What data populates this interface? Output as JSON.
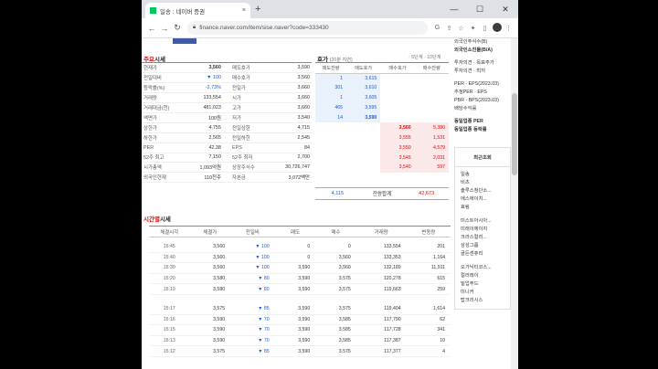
{
  "browser": {
    "tab_title": "일송 : 네이버 증권",
    "tab_close": "×",
    "new_tab": "+",
    "url": "finance.naver.com/item/sise.naver?code=333430",
    "win_min": "—",
    "win_max": "☐",
    "win_close": "✕"
  },
  "quote": {
    "title": "주요시세",
    "title_accent": "주요",
    "rows": [
      {
        "l1": "현재가",
        "v1": "3,560",
        "l2": "매도호가",
        "v2": "3,590"
      },
      {
        "l1": "전일대비",
        "v1": "▼ 100",
        "l2": "매수호가",
        "v2": "3,560"
      },
      {
        "l1": "등락률(%)",
        "v1": "-2.73%",
        "l2": "전일가",
        "v2": "3,660"
      },
      {
        "l1": "거래량",
        "v1": "133,554",
        "l2": "시가",
        "v2": "3,660"
      },
      {
        "l1": "거래대금(천)",
        "v1": "481,023",
        "l2": "고가",
        "v2": "3,660"
      },
      {
        "l1": "액면가",
        "v1": "100원",
        "l2": "저가",
        "v2": "3,540"
      },
      {
        "l1": "상한가",
        "v1": "4,755",
        "l2": "전일상한",
        "v2": "4,715"
      },
      {
        "l1": "하한가",
        "v1": "2,565",
        "l2": "전일하한",
        "v2": "2,545"
      },
      {
        "l1": "PER",
        "v1": "42.38",
        "l2": "EPS",
        "v2": "84"
      },
      {
        "l1": "52주 최고",
        "v1": "7,150",
        "l2": "52주 최저",
        "v2": "2,700"
      },
      {
        "l1": "시가총액",
        "v1": "1,093억원",
        "l2": "상장주식수",
        "v2": "30,726,747"
      },
      {
        "l1": "외국인현재",
        "v1": "110천주",
        "l2": "자본금",
        "v2": "3,072백만"
      }
    ]
  },
  "orderbook": {
    "title": "호가",
    "subtitle": "(20분 지연)",
    "links": "· 5단계 · 10단계",
    "headers": [
      "매도잔량",
      "매도호가",
      "매수호가",
      "매수잔량"
    ],
    "asks": [
      {
        "qty": "1",
        "price": "3,615"
      },
      {
        "qty": "301",
        "price": "3,610"
      },
      {
        "qty": "1",
        "price": "3,605"
      },
      {
        "qty": "465",
        "price": "3,595"
      },
      {
        "qty": "14",
        "price": "3,590"
      }
    ],
    "bids": [
      {
        "price": "3,560",
        "qty": "5,380"
      },
      {
        "price": "3,555",
        "qty": "1,531"
      },
      {
        "price": "3,550",
        "qty": "4,579"
      },
      {
        "price": "3,545",
        "qty": "2,031"
      },
      {
        "price": "3,540",
        "qty": "597"
      }
    ],
    "total_ask": "4,115",
    "total_label": "잔량합계",
    "total_bid": "42,673"
  },
  "timeseries": {
    "title": "시간별시세",
    "title_accent": "시간별",
    "headers": [
      "체결시각",
      "체결가",
      "전일비",
      "매도",
      "매수",
      "거래량",
      "변동량"
    ],
    "groups": [
      [
        {
          "time": "15:45",
          "price": "3,560",
          "diff": "▼ 100",
          "sell": "0",
          "buy": "0",
          "vol": "133,554",
          "chg": "201"
        },
        {
          "time": "15:40",
          "price": "3,560",
          "diff": "▼ 100",
          "sell": "0",
          "buy": "3,560",
          "vol": "133,353",
          "chg": "1,164"
        },
        {
          "time": "15:30",
          "price": "3,560",
          "diff": "▼ 100",
          "sell": "3,590",
          "buy": "3,560",
          "vol": "132,189",
          "chg": "11,911"
        },
        {
          "time": "15:20",
          "price": "3,580",
          "diff": "▼ 80",
          "sell": "3,590",
          "buy": "3,575",
          "vol": "120,278",
          "chg": "615"
        },
        {
          "time": "15:19",
          "price": "3,580",
          "diff": "▼ 80",
          "sell": "3,590",
          "buy": "3,575",
          "vol": "119,663",
          "chg": "259"
        }
      ],
      [
        {
          "time": "15:17",
          "price": "3,575",
          "diff": "▼ 85",
          "sell": "3,590",
          "buy": "3,575",
          "vol": "119,404",
          "chg": "1,614"
        },
        {
          "time": "15:16",
          "price": "3,590",
          "diff": "▼ 70",
          "sell": "3,590",
          "buy": "3,585",
          "vol": "117,790",
          "chg": "62"
        },
        {
          "time": "15:15",
          "price": "3,590",
          "diff": "▼ 70",
          "sell": "3,590",
          "buy": "3,585",
          "vol": "117,728",
          "chg": "341"
        },
        {
          "time": "15:13",
          "price": "3,590",
          "diff": "▼ 70",
          "sell": "3,590",
          "buy": "3,585",
          "vol": "117,387",
          "chg": "10"
        },
        {
          "time": "15:12",
          "price": "3,575",
          "diff": "▼ 85",
          "sell": "3,590",
          "buy": "3,575",
          "vol": "117,377",
          "chg": "4"
        }
      ]
    ]
  },
  "sidebar": {
    "top_lines": [
      "외국인주식수(B)",
      "외국인소진율(B/A)",
      "투자의견 · 목표주가",
      "투자의견 · 최저",
      "PER · EPS(2023.03)",
      "추정PER · EPS",
      "PBR · BPS(2023.03)",
      "배당수익률",
      "동일업종 PER",
      "동일업종 등락률"
    ],
    "recent_title": "최근조회",
    "recent_items": [
      "일송",
      "비츠",
      "솔루스첨단소...",
      "에스에이치...",
      "효림",
      "미스트아시아...",
      "미래이에이치",
      "크라스컬리...",
      "삼성그룹",
      "골든센츄리",
      "오가닉티코스...",
      "컬러레이",
      "밀업푸드",
      "미니커",
      "탑크리시스"
    ]
  }
}
